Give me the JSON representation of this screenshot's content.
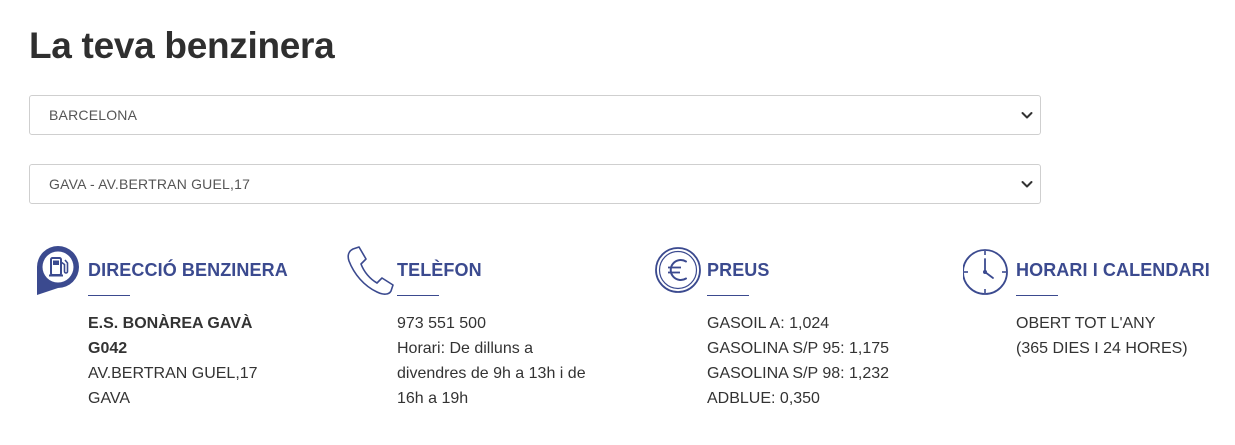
{
  "page": {
    "title": "La teva benzinera"
  },
  "selectors": {
    "province": {
      "value": "BARCELONA"
    },
    "station": {
      "value": "GAVA - AV.BERTRAN GUEL,17"
    }
  },
  "colors": {
    "accent": "#3b4a8f",
    "text": "#333333",
    "border": "#cfcfcf"
  },
  "info": {
    "address": {
      "icon": "fuel-pump-pin-icon",
      "heading": "DIRECCIÓ BENZINERA",
      "name_line1": "E.S. BONÀREA GAVÀ",
      "name_line2": "G042",
      "street": "AV.BERTRAN GUEL,17",
      "city": "GAVA"
    },
    "phone": {
      "icon": "phone-icon",
      "heading": "TELÈFON",
      "number": "973 551 500",
      "hours_lines": [
        "Horari: De dilluns a",
        "divendres de 9h a 13h i de",
        "16h a 19h"
      ]
    },
    "prices": {
      "icon": "euro-icon",
      "heading": "PREUS",
      "items": [
        "GASOIL A: 1,024",
        "GASOLINA S/P 95: 1,175",
        "GASOLINA S/P 98: 1,232",
        "ADBLUE: 0,350"
      ]
    },
    "schedule": {
      "icon": "clock-icon",
      "heading": "HORARI I CALENDARI",
      "lines": [
        "OBERT TOT L'ANY",
        "(365 DIES I 24 HORES)"
      ]
    }
  }
}
